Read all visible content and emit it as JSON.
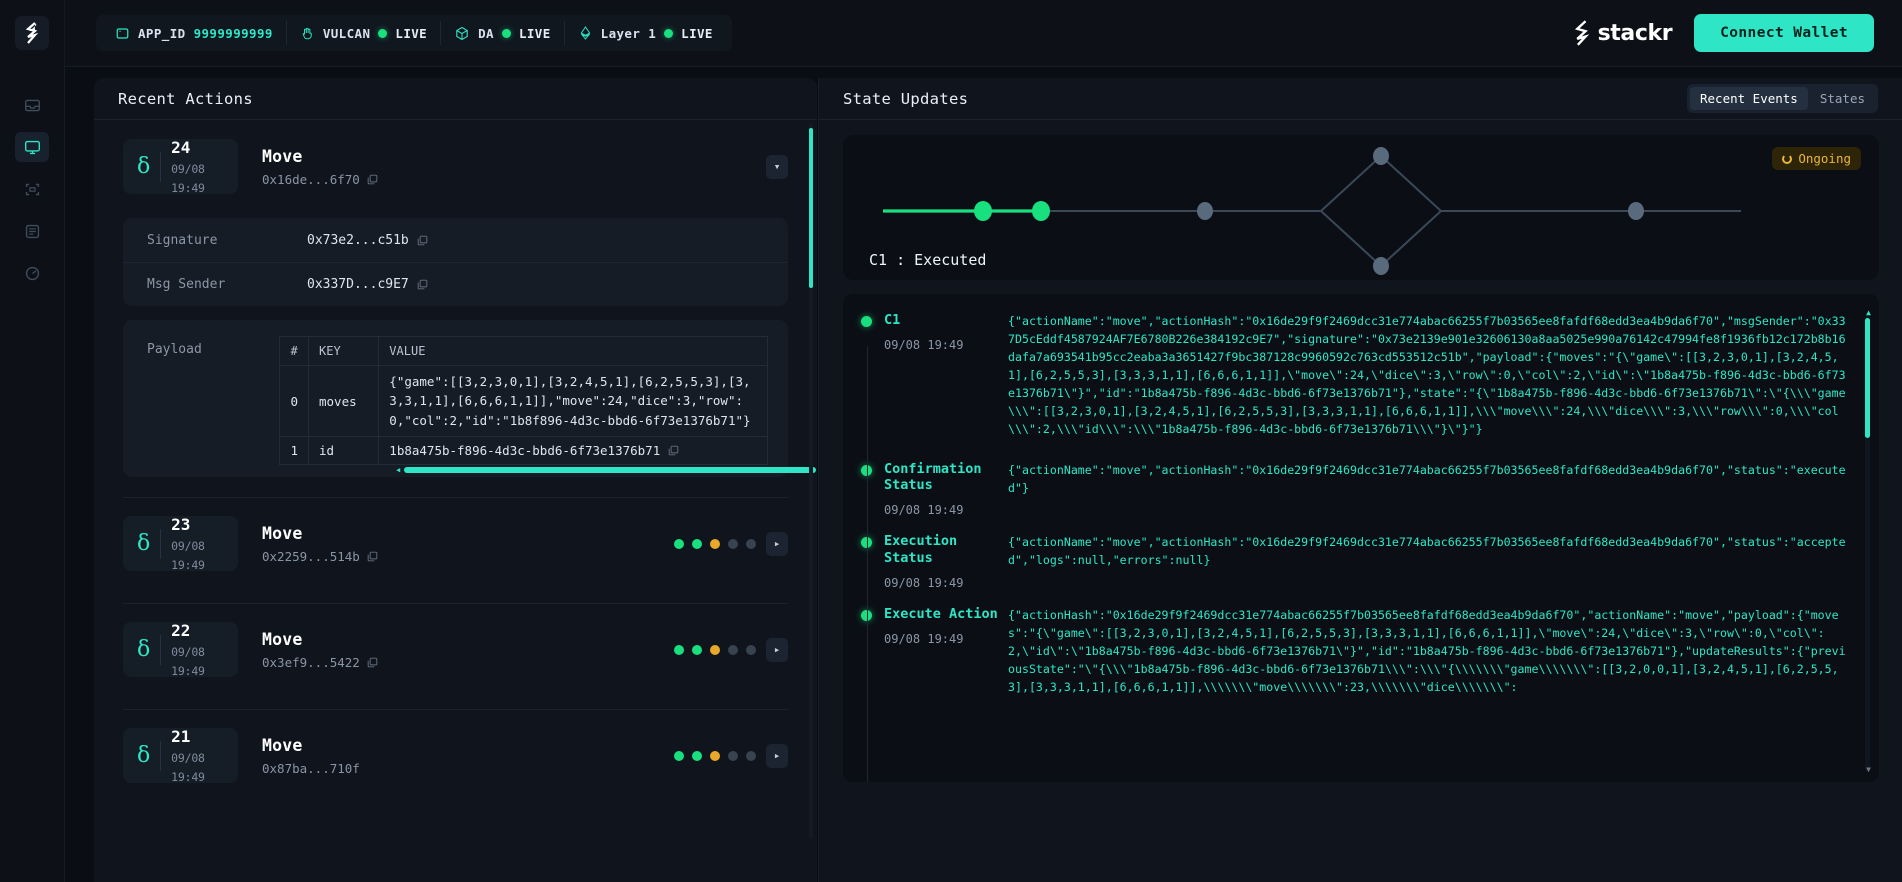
{
  "brand": {
    "name": "stackr",
    "logo_icon": "stackr-logo-icon"
  },
  "topbar": {
    "connect_label": "Connect Wallet",
    "chips": [
      {
        "icon": "app-window-icon",
        "label": "APP_ID",
        "value": "9999999999",
        "status": "",
        "has_status": false
      },
      {
        "icon": "hand-icon",
        "label": "VULCAN",
        "value": "",
        "status": "LIVE",
        "has_status": true
      },
      {
        "icon": "cube-icon",
        "label": "DA",
        "value": "",
        "status": "LIVE",
        "has_status": true
      },
      {
        "icon": "ethereum-icon",
        "label": "Layer 1",
        "value": "",
        "status": "LIVE",
        "has_status": true
      }
    ]
  },
  "rail": {
    "items": [
      {
        "name": "sidebar-item-inbox",
        "icon": "inbox-icon",
        "active": false
      },
      {
        "name": "sidebar-item-monitor",
        "icon": "monitor-icon",
        "active": true
      },
      {
        "name": "sidebar-item-scan",
        "icon": "scan-icon",
        "active": false
      },
      {
        "name": "sidebar-item-logs",
        "icon": "document-icon",
        "active": false
      },
      {
        "name": "sidebar-item-activity",
        "icon": "gauge-icon",
        "active": false
      }
    ]
  },
  "left": {
    "title": "Recent Actions",
    "expanded": {
      "number": "24",
      "timestamp": "09/08 19:49",
      "action_name": "Move",
      "hash": "0x16de...6f70",
      "details": [
        {
          "key": "Signature",
          "value": "0x73e2...c51b"
        },
        {
          "key": "Msg Sender",
          "value": "0x337D...c9E7"
        }
      ],
      "payload_label": "Payload",
      "payload_columns": [
        "#",
        "KEY",
        "VALUE"
      ],
      "payload_rows": [
        {
          "idx": "0",
          "key": "moves",
          "value": "{\"game\":[[3,2,3,0,1],[3,2,4,5,1],[6,2,5,5,3],[3,3,3,1,1],[6,6,6,1,1]],\"move\":24,\"dice\":3,\"row\":0,\"col\":2,\"id\":\"1b8f896-4d3c-bbd6-6f73e1376b71\"}"
        },
        {
          "idx": "1",
          "key": "id",
          "value": "1b8a475b-f896-4d3c-bbd6-6f73e1376b71"
        }
      ]
    },
    "collapsed": [
      {
        "number": "23",
        "timestamp": "09/08 19:49",
        "action_name": "Move",
        "hash": "0x2259...514b",
        "pips": [
          "#18e07f",
          "#18e07f",
          "#e8a82a",
          "#394350",
          "#394350"
        ]
      },
      {
        "number": "22",
        "timestamp": "09/08 19:49",
        "action_name": "Move",
        "hash": "0x3ef9...5422",
        "pips": [
          "#18e07f",
          "#18e07f",
          "#e8a82a",
          "#394350",
          "#394350"
        ]
      },
      {
        "number": "21",
        "timestamp": "09/08 19:49",
        "action_name": "Move",
        "hash": "0x87ba...710f",
        "pips": [
          "#18e07f",
          "#18e07f",
          "#e8a82a",
          "#394350",
          "#394350"
        ]
      }
    ]
  },
  "right": {
    "title": "State Updates",
    "tabs": [
      {
        "label": "Recent Events",
        "active": true
      },
      {
        "label": "States",
        "active": false
      }
    ],
    "graph": {
      "status_badge": "Ongoing",
      "status_color": "#e8b63a",
      "label": "C1 : Executed",
      "progress_color": "#18e07f",
      "idle_color": "#49586b",
      "nodes_done": 2,
      "nodes_total": 7
    },
    "events": [
      {
        "name": "C1",
        "timestamp": "09/08 19:49",
        "json": "{\"actionName\":\"move\",\"actionHash\":\"0x16de29f9f2469dcc31e774abac66255f7b03565ee8fafdf68edd3ea4b9da6f70\",\"msgSender\":\"0x337D5cEddf4587924AF7E6780B226e384192c9E7\",\"signature\":\"0x73e2139e901e32606130a8aa5025e990a76142c47994fe8f1936fb12c172b8b16dafa7a693541b95cc2eaba3a3651427f9bc387128c9960592c763cd553512c51b\",\"payload\":{\"moves\":\"{\\\"game\\\":[[3,2,3,0,1],[3,2,4,5,1],[6,2,5,5,3],[3,3,3,1,1],[6,6,6,1,1]],\\\"move\\\":24,\\\"dice\\\":3,\\\"row\\\":0,\\\"col\\\":2,\\\"id\\\":\\\"1b8a475b-f896-4d3c-bbd6-6f73e1376b71\\\"}\",\"id\":\"1b8a475b-f896-4d3c-bbd6-6f73e1376b71\"},\"state\":\"{\\\"1b8a475b-f896-4d3c-bbd6-6f73e1376b71\\\":\\\"{\\\\\\\"game\\\\\\\":[[3,2,3,0,1],[3,2,4,5,1],[6,2,5,5,3],[3,3,3,1,1],[6,6,6,1,1]],\\\\\\\"move\\\\\\\":24,\\\\\\\"dice\\\\\\\":3,\\\\\\\"row\\\\\\\":0,\\\\\\\"col\\\\\\\":2,\\\\\\\"id\\\\\\\":\\\\\\\"1b8a475b-f896-4d3c-bbd6-6f73e1376b71\\\\\\\"}\\\"}\"}"
      },
      {
        "name": "Confirmation Status",
        "timestamp": "09/08 19:49",
        "json": "{\"actionName\":\"move\",\"actionHash\":\"0x16de29f9f2469dcc31e774abac66255f7b03565ee8fafdf68edd3ea4b9da6f70\",\"status\":\"executed\"}"
      },
      {
        "name": "Execution Status",
        "timestamp": "09/08 19:49",
        "json": "{\"actionName\":\"move\",\"actionHash\":\"0x16de29f9f2469dcc31e774abac66255f7b03565ee8fafdf68edd3ea4b9da6f70\",\"status\":\"accepted\",\"logs\":null,\"errors\":null}"
      },
      {
        "name": "Execute Action",
        "timestamp": "09/08 19:49",
        "json": "{\"actionHash\":\"0x16de29f9f2469dcc31e774abac66255f7b03565ee8fafdf68edd3ea4b9da6f70\",\"actionName\":\"move\",\"payload\":{\"moves\":\"{\\\"game\\\":[[3,2,3,0,1],[3,2,4,5,1],[6,2,5,5,3],[3,3,3,1,1],[6,6,6,1,1]],\\\"move\\\":24,\\\"dice\\\":3,\\\"row\\\":0,\\\"col\\\":2,\\\"id\\\":\\\"1b8a475b-f896-4d3c-bbd6-6f73e1376b71\\\"}\",\"id\":\"1b8a475b-f896-4d3c-bbd6-6f73e1376b71\"},\"updateResults\":{\"previousState\":\"\\\"{\\\\\\\"1b8a475b-f896-4d3c-bbd6-6f73e1376b71\\\\\\\":\\\\\\\"{\\\\\\\\\\\\\\\"game\\\\\\\\\\\\\\\":[[3,2,0,0,1],[3,2,4,5,1],[6,2,5,5,3],[3,3,3,1,1],[6,6,6,1,1]],\\\\\\\\\\\\\\\"move\\\\\\\\\\\\\\\":23,\\\\\\\\\\\\\\\"dice\\\\\\\\\\\\\\\":"
      }
    ]
  },
  "colors": {
    "accent": "#2ee6c5",
    "live_green": "#18e07f",
    "warning": "#e8b63a",
    "bg": "#0a0e14",
    "panel": "#10151d",
    "card": "#151c26"
  }
}
